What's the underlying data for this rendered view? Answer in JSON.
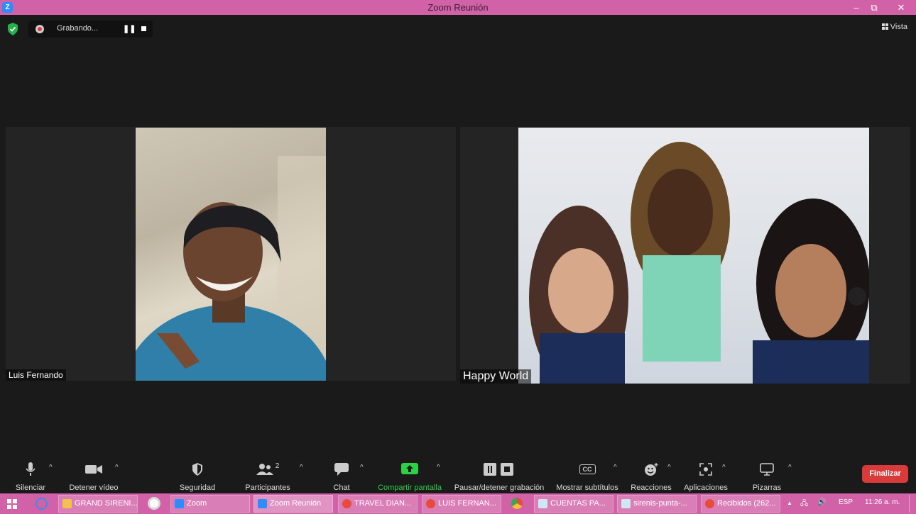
{
  "window": {
    "title": "Zoom Reunión",
    "minimize": "–",
    "restore": "⧉",
    "close": "✕"
  },
  "recording": {
    "status": "Grabando...",
    "pause": "❚❚"
  },
  "view": {
    "label": "Vista"
  },
  "participants": [
    {
      "name": "Luis Fernando"
    },
    {
      "name": "Happy World"
    }
  ],
  "toolbar": {
    "mute": "Silenciar",
    "video": "Detener vídeo",
    "security": "Seguridad",
    "participants": "Participantes",
    "participants_count": "2",
    "chat": "Chat",
    "share": "Compartir pantalla",
    "pause_rec": "Pausar/detener grabación",
    "captions": "Mostrar subtítulos",
    "captions_icon": "CC",
    "reactions": "Reacciones",
    "apps": "Aplicaciones",
    "whiteboards": "Pizarras",
    "end": "Finalizar",
    "caret": "^",
    "colors": {
      "share": "#2ed046",
      "end": "#d93b3b"
    }
  },
  "taskbar": {
    "items": [
      {
        "label": "GRAND SIRENI...",
        "icon": "folder-icon"
      },
      {
        "label": "Zoom",
        "icon": "zoom-icon"
      },
      {
        "label": "Zoom Reunión",
        "icon": "zoom-icon"
      },
      {
        "label": "TRAVEL DIAN...",
        "icon": "chrome-icon"
      },
      {
        "label": "LUIS FERNAN...",
        "icon": "chrome-icon"
      },
      {
        "label": "CUENTAS PA...",
        "icon": "sheet-icon"
      },
      {
        "label": "sirenis-punta-...",
        "icon": "sheet-icon"
      },
      {
        "label": "Recibidos (262...",
        "icon": "chrome-icon"
      }
    ],
    "lang": "ESP",
    "time": "11:26 a. m.",
    "tray_caret": "▲",
    "volume": "🔊",
    "network": "🖧",
    "color": "#d262a8"
  }
}
